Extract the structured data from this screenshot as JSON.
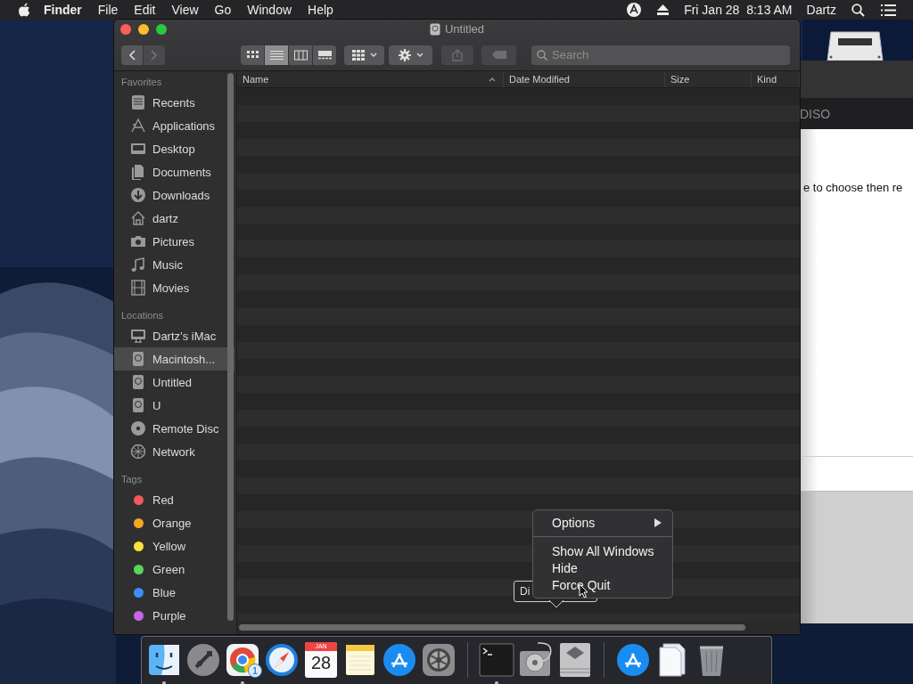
{
  "menubar": {
    "app": "Finder",
    "menus": [
      "File",
      "Edit",
      "View",
      "Go",
      "Window",
      "Help"
    ],
    "clock": "Fri Jan 28  8:13 AM",
    "user": "Dartz"
  },
  "background_window": {
    "tab_text": "DISO",
    "body_text": "e to choose then re"
  },
  "finder": {
    "title": "Untitled",
    "view_modes": [
      {
        "kind": "icons",
        "selected": false
      },
      {
        "kind": "list",
        "selected": true
      },
      {
        "kind": "columns",
        "selected": false
      },
      {
        "kind": "gallery",
        "selected": false
      }
    ],
    "search": {
      "placeholder": "Search"
    },
    "sidebar": [
      {
        "heading": "Favorites",
        "items": [
          {
            "kind": "recents",
            "label": "Recents",
            "selected": false
          },
          {
            "kind": "applications",
            "label": "Applications",
            "selected": false
          },
          {
            "kind": "desktop",
            "label": "Desktop",
            "selected": false
          },
          {
            "kind": "documents",
            "label": "Documents",
            "selected": false
          },
          {
            "kind": "downloads",
            "label": "Downloads",
            "selected": false
          },
          {
            "kind": "home",
            "label": "dartz",
            "selected": false
          },
          {
            "kind": "pictures",
            "label": "Pictures",
            "selected": false
          },
          {
            "kind": "music",
            "label": "Music",
            "selected": false
          },
          {
            "kind": "movies",
            "label": "Movies",
            "selected": false
          }
        ]
      },
      {
        "heading": "Locations",
        "items": [
          {
            "kind": "computer",
            "label": "Dartz’s iMac",
            "selected": false
          },
          {
            "kind": "disk",
            "label": "Macintosh...",
            "selected": true
          },
          {
            "kind": "disk",
            "label": "Untitled",
            "selected": false
          },
          {
            "kind": "disk",
            "label": "U",
            "selected": false
          },
          {
            "kind": "disc",
            "label": "Remote Disc",
            "selected": false
          },
          {
            "kind": "network",
            "label": "Network",
            "selected": false
          }
        ]
      },
      {
        "heading": "Tags",
        "items": [
          {
            "kind": "tag",
            "label": "Red",
            "color": "#f05a5a",
            "selected": false
          },
          {
            "kind": "tag",
            "label": "Orange",
            "color": "#f5a623",
            "selected": false
          },
          {
            "kind": "tag",
            "label": "Yellow",
            "color": "#f7e13a",
            "selected": false
          },
          {
            "kind": "tag",
            "label": "Green",
            "color": "#5ad65a",
            "selected": false
          },
          {
            "kind": "tag",
            "label": "Blue",
            "color": "#3d8ef7",
            "selected": false
          },
          {
            "kind": "tag",
            "label": "Purple",
            "color": "#c664e8",
            "selected": false
          }
        ]
      }
    ],
    "columns": [
      "Name",
      "Date Modified",
      "Size",
      "Kind"
    ]
  },
  "context_menu": {
    "groups": [
      {
        "items": [
          {
            "label": "Options",
            "submenu": true
          }
        ]
      },
      {
        "items": [
          {
            "label": "Show All Windows",
            "submenu": false
          },
          {
            "label": "Hide",
            "submenu": false
          },
          {
            "label": "Force Quit",
            "submenu": false
          }
        ]
      }
    ]
  },
  "tooltip": "Di",
  "dock": {
    "apps": [
      {
        "kind": "finder",
        "running": true
      },
      {
        "kind": "launchpad",
        "running": false
      },
      {
        "kind": "browser",
        "running": true,
        "badge": "1"
      },
      {
        "kind": "compass",
        "running": false
      },
      {
        "kind": "calendar",
        "running": false,
        "month": "JAN",
        "day": "28"
      },
      {
        "kind": "notes",
        "running": false
      },
      {
        "kind": "store",
        "running": false
      },
      {
        "kind": "settings",
        "running": false
      },
      {
        "kind": "separator"
      },
      {
        "kind": "terminal",
        "running": true
      },
      {
        "kind": "diskutility",
        "running": false
      },
      {
        "kind": "bootdrive",
        "running": false
      },
      {
        "kind": "separator"
      },
      {
        "kind": "store",
        "running": false
      },
      {
        "kind": "documents",
        "running": false
      },
      {
        "kind": "trash",
        "running": false
      }
    ]
  }
}
